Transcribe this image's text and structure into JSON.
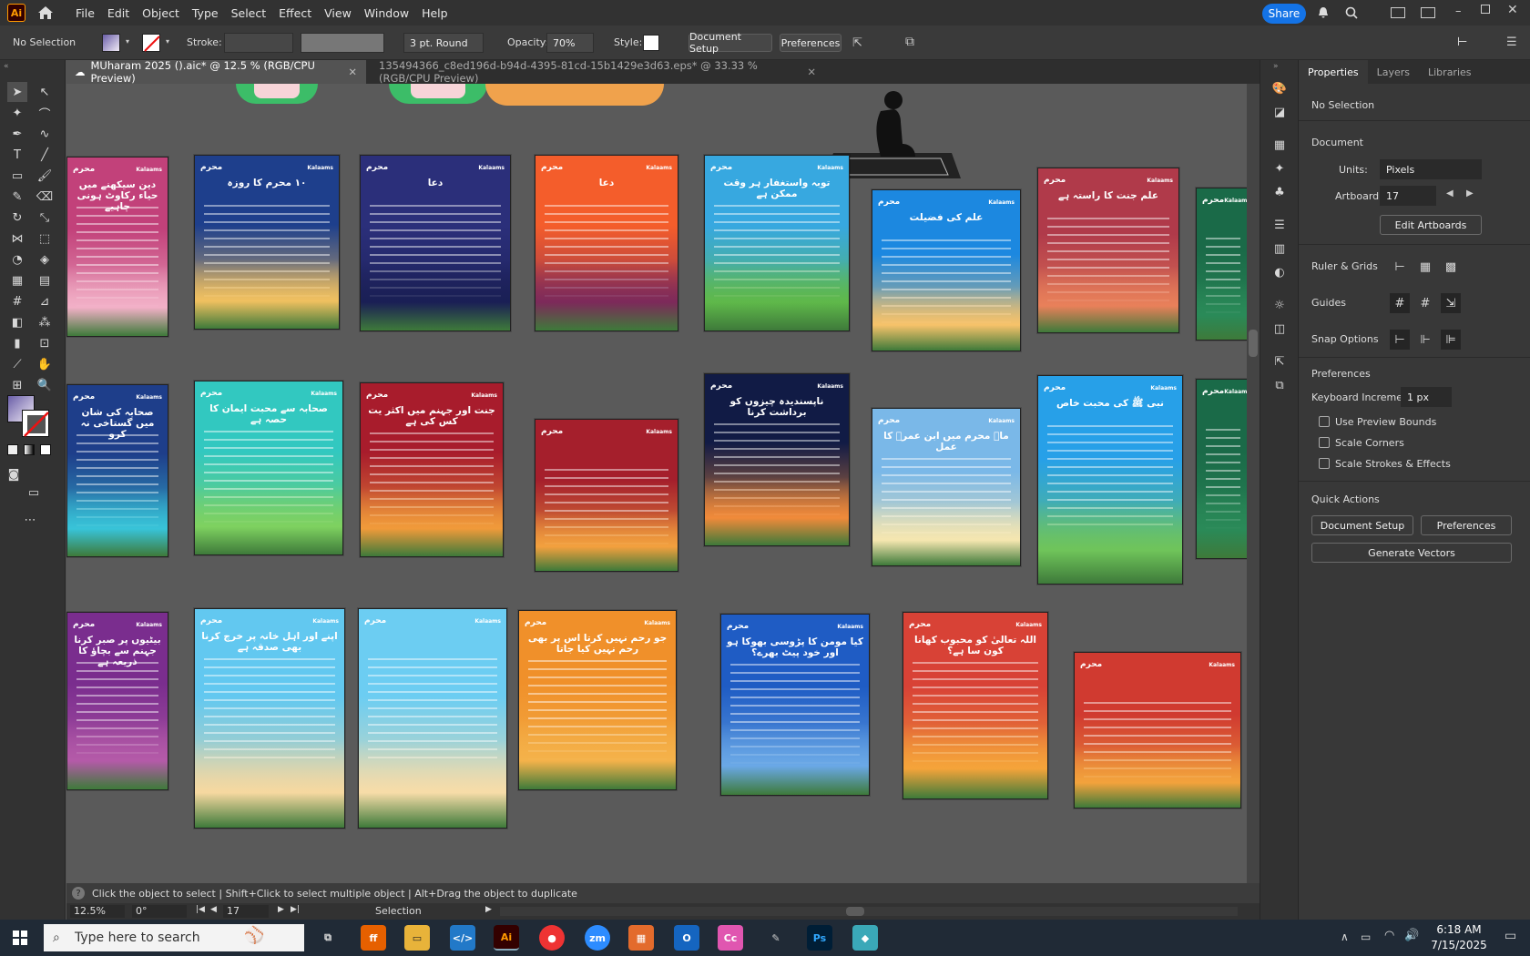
{
  "menu": {
    "app_icon": "Ai",
    "items": [
      "File",
      "Edit",
      "Object",
      "Type",
      "Select",
      "Effect",
      "View",
      "Window",
      "Help"
    ],
    "share_label": "Share"
  },
  "control": {
    "selection": "No Selection",
    "stroke_label": "Stroke:",
    "brush": "3 pt. Round",
    "opacity_label": "Opacity:",
    "opacity_value": "70%",
    "style_label": "Style:",
    "document_setup": "Document Setup",
    "preferences": "Preferences"
  },
  "tabs": [
    {
      "label": "MUharam 2025 ().aic* @ 12.5 % (RGB/CPU Preview)"
    },
    {
      "label": "135494366_c8ed196d-b94d-4395-81cd-15b1429e3d63.eps* @ 33.33 % (RGB/CPU Preview)"
    }
  ],
  "artboards": [
    {
      "brand": "Kalaams",
      "title": "دین سیکھنے میں حیاء رکاوٹ ہونی چاہیے",
      "top": "#c2417a",
      "bottom": "#f2b0c7"
    },
    {
      "brand": "Kalaams",
      "title": "۱۰ محرم کا روزہ",
      "top": "#1e3f8c",
      "bottom": "#f0c060"
    },
    {
      "brand": "Kalaams",
      "title": "دعا",
      "top": "#2b2f7a",
      "bottom": "#1a1f55"
    },
    {
      "brand": "Kalaams",
      "title": "دعا",
      "top": "#f45d2b",
      "bottom": "#7d2a5a"
    },
    {
      "brand": "Kalaams",
      "title": "توبہ واستغفار ہر وقت ممکن ہے",
      "top": "#37a8e0",
      "bottom": "#5fb84a"
    },
    {
      "brand": "Kalaams",
      "title": "علم کی فضیلت",
      "top": "#1c88e0",
      "bottom": "#f6c26a"
    },
    {
      "brand": "Kalaams",
      "title": "علم جنت کا راستہ ہے",
      "top": "#b03a4a",
      "bottom": "#e8805a"
    },
    {
      "brand": "Kalaams",
      "title": "صحابہ کی شان میں گستاخی نہ کرو",
      "top": "#1e3e8a",
      "bottom": "#38c3d8"
    },
    {
      "brand": "Kalaams",
      "title": "صحابہ سے محبت ایمان کا حصہ ہے",
      "top": "#32c8c0",
      "bottom": "#7ed160"
    },
    {
      "brand": "Kalaams",
      "title": "جنت اور جہنم میں اکثر یت کس کی ہے",
      "top": "#a81c2c",
      "bottom": "#f09a3a"
    },
    {
      "brand": "Kalaams",
      "title": "",
      "top": "#a51f2c",
      "bottom": "#f2a03e"
    },
    {
      "brand": "Kalaams",
      "title": "ناپسندیدہ چیزوں کو برداشت کرنا",
      "top": "#111b45",
      "bottom": "#f08a3a"
    },
    {
      "brand": "Kalaams",
      "title": "ماہ محرم میں ابن عمرؓ کا عمل",
      "top": "#7ab8e8",
      "bottom": "#f5e6b0"
    },
    {
      "brand": "Kalaams",
      "title": "نبی ﷺ کی محبت خاص",
      "top": "#27a0e8",
      "bottom": "#6fc45a"
    },
    {
      "brand": "Kalaams",
      "title": "بیٹیوں پر صبر کرنا جہنم سے بچاؤ کا ذریعہ ہے",
      "top": "#7a2d8e",
      "bottom": "#b45aa8"
    },
    {
      "brand": "Kalaams",
      "title": "اپنے اور اہل خانہ پر خرچ کرنا بھی صدقہ ہے",
      "top": "#62c8f0",
      "bottom": "#f6d8a0"
    },
    {
      "brand": "Kalaams",
      "title": "",
      "top": "#6ccdf2",
      "bottom": "#f7dca8"
    },
    {
      "brand": "Kalaams",
      "title": "جو رحم نہیں کرتا اس پر بھی رحم نہیں کیا جاتا",
      "top": "#f0902a",
      "bottom": "#f4b24a"
    },
    {
      "brand": "Kalaams",
      "title": "کیا مومن کا پڑوسی بھوکا ہو اور خود پیٹ بھرے؟",
      "top": "#1f5cc4",
      "bottom": "#6aa8e6"
    },
    {
      "brand": "Kalaams",
      "title": "اللہ تعالیٰ کو محبوب کھانا کون سا ہے؟",
      "top": "#d84236",
      "bottom": "#f5a43a"
    },
    {
      "brand": "Kalaams",
      "title": "",
      "top": "#d03a30",
      "bottom": "#f2a23c"
    },
    {
      "brand": "Kalaams",
      "title": "",
      "top": "#1a6a48",
      "bottom": "#2a8a58"
    }
  ],
  "panel": {
    "tabs": [
      "Properties",
      "Layers",
      "Libraries"
    ],
    "no_selection": "No Selection",
    "document": "Document",
    "units_label": "Units:",
    "units_value": "Pixels",
    "artboard_label": "Artboard:",
    "artboard_value": "17",
    "edit_artboards": "Edit Artboards",
    "rulers": "Ruler & Grids",
    "guides": "Guides",
    "snap": "Snap Options",
    "preferences": "Preferences",
    "keyboard_label": "Keyboard Increment:",
    "keyboard_value": "1 px",
    "cb1": "Use Preview Bounds",
    "cb2": "Scale Corners",
    "cb3": "Scale Strokes & Effects",
    "quick": "Quick Actions",
    "doc_setup": "Document Setup",
    "prefs": "Preferences",
    "gen_vectors": "Generate Vectors"
  },
  "status": {
    "hint": "Click the object to select  |  Shift+Click to select multiple object  |  Alt+Drag the object to duplicate",
    "zoom": "12.5%",
    "angle": "0°",
    "artboard": "17",
    "mode": "Selection"
  },
  "taskbar": {
    "search": "Type here to search",
    "time": "6:18 AM",
    "date": "7/15/2025"
  }
}
